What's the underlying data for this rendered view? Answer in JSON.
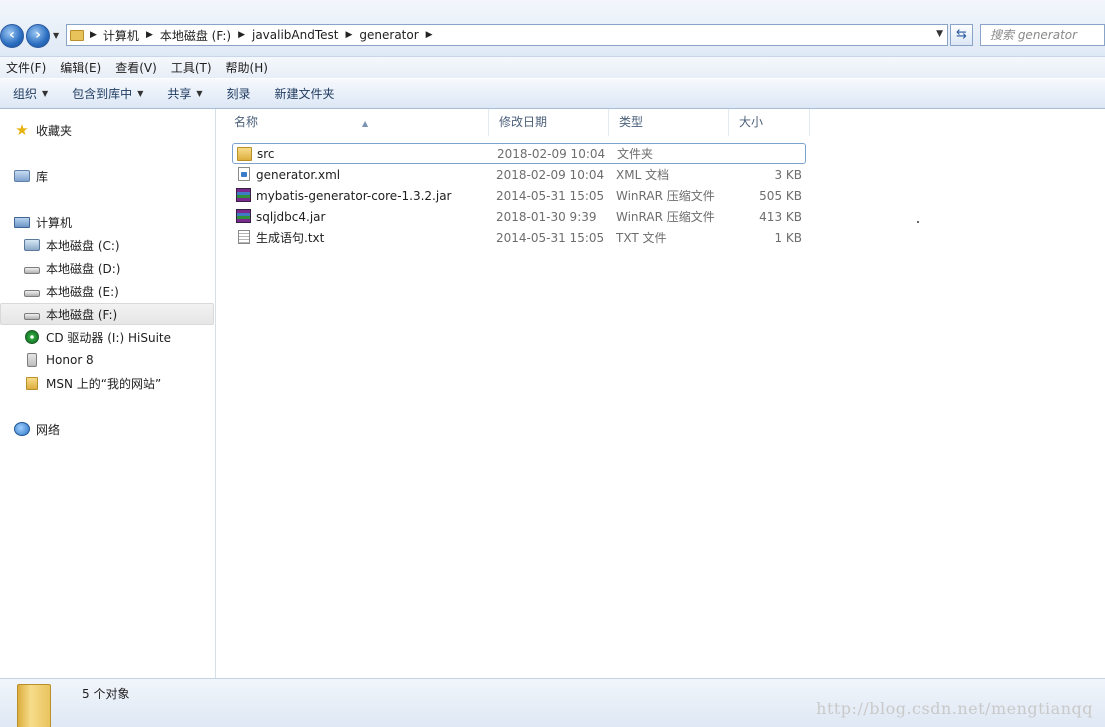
{
  "address": {
    "breadcrumbs": [
      "计算机",
      "本地磁盘 (F:)",
      "javalibAndTest",
      "generator"
    ],
    "search_placeholder": "搜索 generator"
  },
  "menu": [
    "文件(F)",
    "编辑(E)",
    "查看(V)",
    "工具(T)",
    "帮助(H)"
  ],
  "toolbar": {
    "organize": "组织",
    "include_in_library": "包含到库中",
    "share": "共享",
    "burn": "刻录",
    "new_folder": "新建文件夹"
  },
  "nav": {
    "favorites": "收藏夹",
    "libraries": "库",
    "computer": "计算机",
    "drives": [
      {
        "label": "本地磁盘 (C:)",
        "icon": "system-drive-icon"
      },
      {
        "label": "本地磁盘 (D:)",
        "icon": "drive-icon"
      },
      {
        "label": "本地磁盘 (E:)",
        "icon": "drive-icon"
      },
      {
        "label": "本地磁盘 (F:)",
        "icon": "drive-icon",
        "selected": true
      },
      {
        "label": "CD 驱动器 (I:) HiSuite",
        "icon": "cd-drive-icon"
      },
      {
        "label": "Honor 8",
        "icon": "phone-icon"
      },
      {
        "label": "MSN 上的“我的网站”",
        "icon": "folder-icon"
      }
    ],
    "network": "网络"
  },
  "columns": {
    "name": "名称",
    "date": "修改日期",
    "type": "类型",
    "size": "大小"
  },
  "files": [
    {
      "name": "src",
      "date": "2018-02-09 10:04",
      "type": "文件夹",
      "size": "",
      "icon": "folder-icon"
    },
    {
      "name": "generator.xml",
      "date": "2018-02-09 10:04",
      "type": "XML 文档",
      "size": "3 KB",
      "icon": "xml-file-icon"
    },
    {
      "name": "mybatis-generator-core-1.3.2.jar",
      "date": "2014-05-31 15:05",
      "type": "WinRAR 压缩文件",
      "size": "505 KB",
      "icon": "winrar-archive-icon"
    },
    {
      "name": "sqljdbc4.jar",
      "date": "2018-01-30 9:39",
      "type": "WinRAR 压缩文件",
      "size": "413 KB",
      "icon": "winrar-archive-icon"
    },
    {
      "name": "生成语句.txt",
      "date": "2014-05-31 15:05",
      "type": "TXT 文件",
      "size": "1 KB",
      "icon": "text-file-icon"
    }
  ],
  "status": {
    "count": "5 个对象"
  },
  "watermark": "http://blog.csdn.net/mengtianqq"
}
